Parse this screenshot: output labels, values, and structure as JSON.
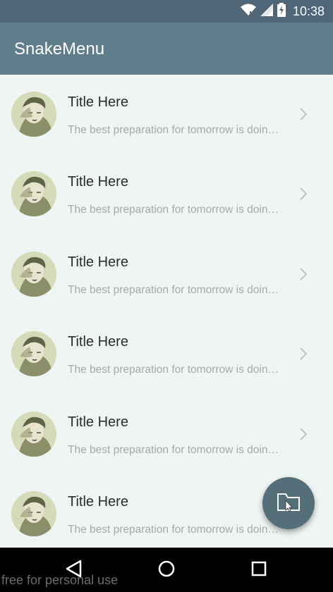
{
  "status_bar": {
    "time": "10:38"
  },
  "app_bar": {
    "title": "SnakeMenu"
  },
  "list": {
    "items": [
      {
        "title": "Title Here",
        "subtitle": "The best preparation for tomorrow is doing your best today"
      },
      {
        "title": "Title Here",
        "subtitle": "The best preparation for tomorrow is doing your best today"
      },
      {
        "title": "Title Here",
        "subtitle": "The best preparation for tomorrow is doing your best today"
      },
      {
        "title": "Title Here",
        "subtitle": "The best preparation for tomorrow is doing your best today"
      },
      {
        "title": "Title Here",
        "subtitle": "The best preparation for tomorrow is doing your best today"
      },
      {
        "title": "Title Here",
        "subtitle": "The best preparation for tomorrow is doing your best today"
      }
    ]
  },
  "watermark": "free for personal use",
  "colors": {
    "status_bar": "#4e6678",
    "app_bar": "#607d8b",
    "background": "#eef5f2",
    "fab": "#546e7a"
  },
  "icons": {
    "fab": "folder-icon",
    "nav": [
      "back-icon",
      "home-icon",
      "recents-icon"
    ]
  }
}
